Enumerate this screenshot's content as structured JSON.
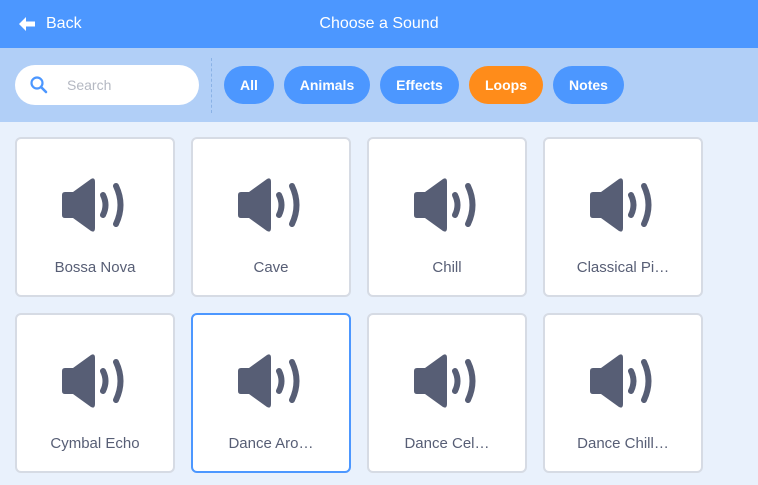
{
  "header": {
    "back_label": "Back",
    "title": "Choose a Sound"
  },
  "search": {
    "placeholder": "Search",
    "value": ""
  },
  "tags": [
    {
      "label": "All",
      "active": false
    },
    {
      "label": "Animals",
      "active": false
    },
    {
      "label": "Effects",
      "active": false
    },
    {
      "label": "Loops",
      "active": true
    },
    {
      "label": "Notes",
      "active": false
    }
  ],
  "sounds": [
    {
      "label": "Bossa Nova",
      "selected": false
    },
    {
      "label": "Cave",
      "selected": false
    },
    {
      "label": "Chill",
      "selected": false
    },
    {
      "label": "Classical Pi…",
      "selected": false
    },
    {
      "label": "Cymbal Echo",
      "selected": false
    },
    {
      "label": "Dance Aro…",
      "selected": true
    },
    {
      "label": "Dance Cel…",
      "selected": false
    },
    {
      "label": "Dance Chill…",
      "selected": false
    }
  ],
  "colors": {
    "accent": "#4c97ff",
    "active_tag": "#ff8c1a",
    "icon": "#575e75"
  }
}
